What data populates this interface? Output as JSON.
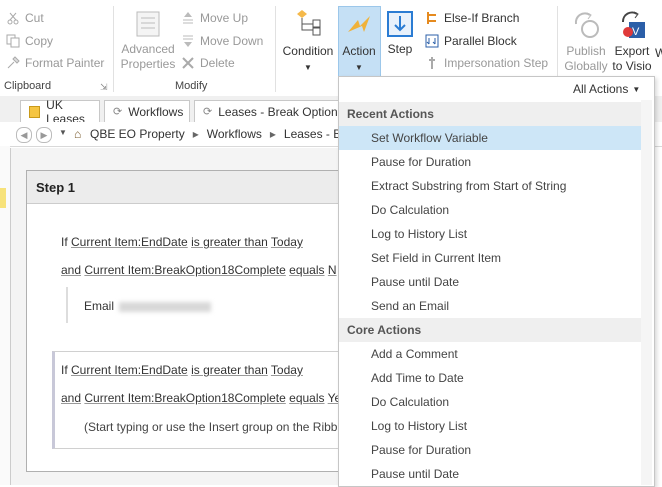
{
  "ribbon": {
    "clipboard": {
      "cut": "Cut",
      "copy": "Copy",
      "format_painter": "Format Painter",
      "label": "Clipboard"
    },
    "modify": {
      "advanced_properties": "Advanced Properties",
      "move_up": "Move Up",
      "move_down": "Move Down",
      "delete": "Delete",
      "label": "Modify"
    },
    "insert": {
      "condition": "Condition",
      "action": "Action",
      "step": "Step",
      "else_if": "Else-If Branch",
      "parallel": "Parallel Block",
      "impersonation": "Impersonation Step"
    },
    "manage": {
      "publish_globally": "Publish Globally",
      "export_to_visio": "Export to Visio",
      "overflow": "W"
    }
  },
  "tabs": [
    {
      "label": "UK Leases"
    },
    {
      "label": "Workflows"
    },
    {
      "label": "Leases - Break Option A"
    }
  ],
  "breadcrumb": [
    "QBE EO Property",
    "Workflows",
    "Leases - B"
  ],
  "designer": {
    "step_title": "Step 1",
    "block1": {
      "if": "If",
      "field1": "Current Item:EndDate",
      "op1": "is greater than",
      "val1": "Today",
      "and": "and",
      "field2": "Current Item:BreakOption18Complete",
      "op2": "equals",
      "val2": "N",
      "action_text": "Email"
    },
    "block2": {
      "if": "If",
      "field1": "Current Item:EndDate",
      "op1": "is greater than",
      "val1": "Today",
      "and": "and",
      "field2": "Current Item:BreakOption18Complete",
      "op2": "equals",
      "val2": "Ye",
      "hint": "(Start typing or use the Insert group on the Ribbo"
    }
  },
  "action_menu": {
    "filter": "All Actions",
    "recent_header": "Recent Actions",
    "recent": [
      "Set Workflow Variable",
      "Pause for Duration",
      "Extract Substring from Start of String",
      "Do Calculation",
      "Log to History List",
      "Set Field in Current Item",
      "Pause until Date",
      "Send an Email"
    ],
    "core_header": "Core Actions",
    "core": [
      "Add a Comment",
      "Add Time to Date",
      "Do Calculation",
      "Log to History List",
      "Pause for Duration",
      "Pause until Date"
    ]
  },
  "colors": {
    "accent": "#2b7cd3",
    "selected": "#cde6f7",
    "ribbon_active": "#c5e0f5"
  }
}
